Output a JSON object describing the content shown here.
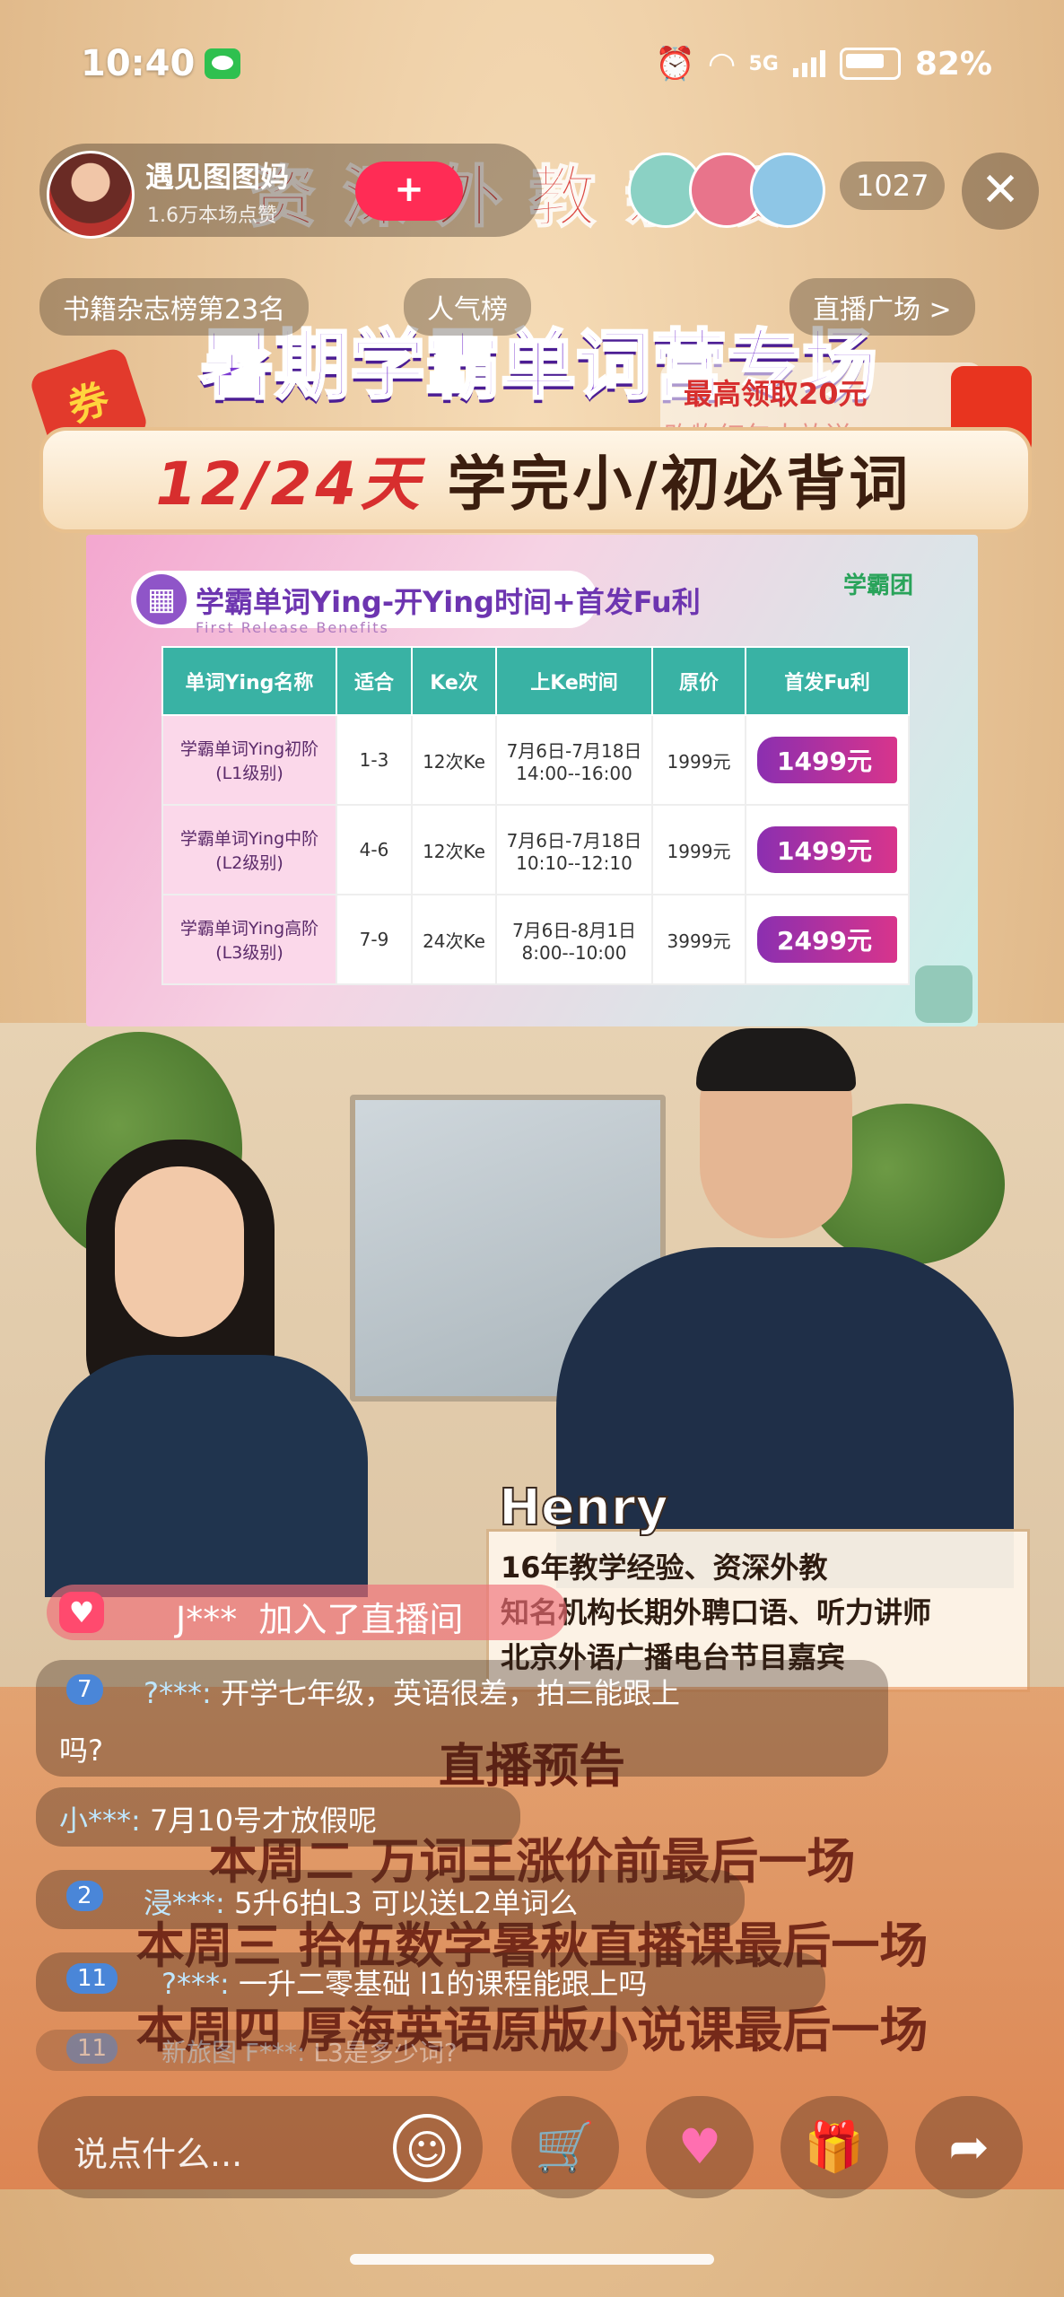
{
  "status_bar": {
    "time": "10:40",
    "network": "5G",
    "battery": "82%"
  },
  "host": {
    "name": "遇见图图妈",
    "fans": "1.6万本场点赞",
    "follow_label": "+",
    "viewer_count": "1027",
    "close_label": "✕"
  },
  "tags": {
    "rank": "书籍杂志榜第23名",
    "popularity": "人气榜",
    "plaza": "直播广场 >"
  },
  "banner": {
    "top_text": "资深外教亲授",
    "title": "暑期学霸单词营专场",
    "subtitle_highlight": "12/24天",
    "subtitle_rest": " 学完小/初必背词",
    "coupon": "券",
    "redpacket_main": "最高领取20元",
    "redpacket_sub": "购物红包大放送"
  },
  "schedule": {
    "title": "学霸单词Ying-开Ying时间+首发Fu利",
    "subtitle": "First Release Benefits",
    "logo": "学霸团",
    "headers": [
      "单词Ying名称",
      "适合",
      "Ke次",
      "上Ke时间",
      "原价",
      "首发Fu利"
    ],
    "rows": [
      {
        "name": "学霸单词Ying初阶",
        "level": "(L1级别)",
        "grade": "1-3",
        "sessions": "12次Ke",
        "time1": "7月6日-7月18日",
        "time2": "14:00--16:00",
        "price": "1999元",
        "promo": "1499元"
      },
      {
        "name": "学霸单词Ying中阶",
        "level": "(L2级别)",
        "grade": "4-6",
        "sessions": "12次Ke",
        "time1": "7月6日-7月18日",
        "time2": "10:10--12:10",
        "price": "1999元",
        "promo": "1499元"
      },
      {
        "name": "学霸单词Ying高阶",
        "level": "(L3级别)",
        "grade": "7-9",
        "sessions": "24次Ke",
        "time1": "7月6日-8月1日",
        "time2": "8:00--10:00",
        "price": "3999元",
        "promo": "2499元"
      }
    ]
  },
  "teacher": {
    "name": "Henry",
    "lines": [
      "16年教学经验、资深外教",
      "知名机构长期外聘口语、听力讲师",
      "北京外语广播电台节目嘉宾"
    ]
  },
  "preview": {
    "title": "直播预告",
    "lines": [
      "本周二 万词王涨价前最后一场",
      "本周三 拾伍数学暑秋直播课最后一场",
      "本周四 厚海英语原版小说课最后一场"
    ]
  },
  "chat": {
    "join": {
      "user": "J***",
      "text": "加入了直播间"
    },
    "messages": [
      {
        "level": "7",
        "user": "?***:",
        "text": "开学七年级，英语很差，拍三能跟上",
        "cont": "吗?"
      },
      {
        "level": "",
        "user": "小***:",
        "text": "7月10号才放假呢"
      },
      {
        "level": "2",
        "user": "浸***:",
        "text": "5升6拍L3 可以送L2单词么"
      },
      {
        "level": "11",
        "user": "?***:",
        "text": "一升二零基础 l1的课程能跟上吗"
      },
      {
        "level": "11",
        "user": "新旅图 F***:",
        "text": "L3是多少词?"
      }
    ]
  },
  "input": {
    "placeholder": "说点什么..."
  },
  "icons": {
    "emoji": "emoji-icon",
    "cart": "cart-icon",
    "like": "heart-icon",
    "gift": "gift-icon",
    "share": "share-icon"
  },
  "colors": {
    "accent_purple": "#7c3ad2",
    "accent_red": "#d72e2e",
    "table_header": "#39b2a4"
  }
}
